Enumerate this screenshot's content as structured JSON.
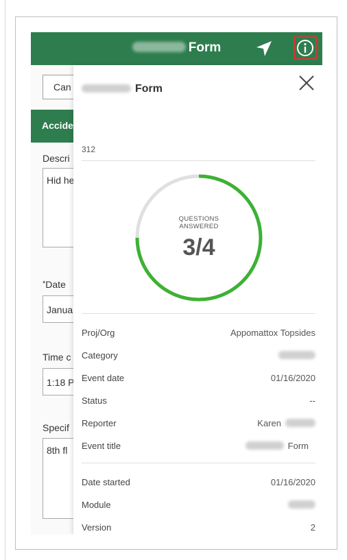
{
  "app_bar": {
    "title_visible": "Form",
    "title_redacted": "Accident",
    "accent_color": "#2e7d4e",
    "nav_icon": "location-arrow-icon",
    "info_icon": "info-circle-icon"
  },
  "background_form": {
    "cancel_label": "Can",
    "section_label": "Accide",
    "description_label": "Descri",
    "description_value": "Hid he",
    "date_label": "Date",
    "date_required_mark": "*",
    "date_value": "Janua",
    "time_label": "Time c",
    "time_value": "1:18 P",
    "specific_label": "Specif",
    "specific_value": "8th fl"
  },
  "info_panel": {
    "title_visible": "Form",
    "id": "312",
    "progress": {
      "caption_line1": "QUESTIONS",
      "caption_line2": "ANSWERED",
      "value": "3/4",
      "answered": 3,
      "total": 4,
      "color": "#3db135",
      "track_color": "#e0e0e0"
    },
    "details": [
      {
        "key": "Proj/Org",
        "value": "Appomattox Topsides"
      },
      {
        "key": "Category",
        "value": ""
      },
      {
        "key": "Event date",
        "value": "01/16/2020"
      },
      {
        "key": "Status",
        "value": "--"
      },
      {
        "key": "Reporter",
        "value": "Karen"
      },
      {
        "key": "Event title",
        "value": "Form"
      }
    ],
    "meta": [
      {
        "key": "Date started",
        "value": "01/16/2020"
      },
      {
        "key": "Module",
        "value": ""
      },
      {
        "key": "Version",
        "value": "2"
      }
    ]
  }
}
